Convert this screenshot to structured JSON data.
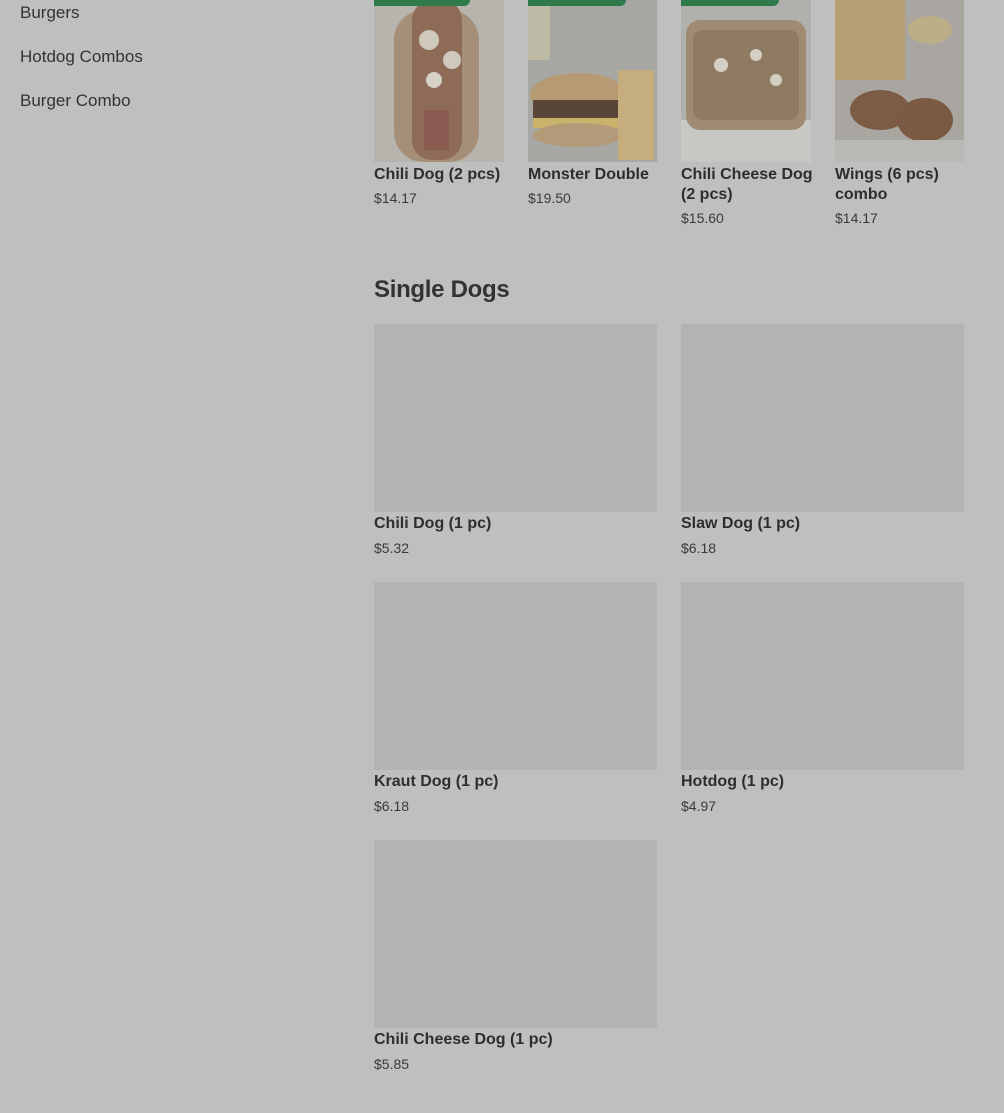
{
  "sidebar": {
    "items": [
      {
        "label": "Burgers"
      },
      {
        "label": "Hotdog Combos"
      },
      {
        "label": "Burger Combo"
      }
    ]
  },
  "featured": [
    {
      "name": "Chili Dog (2 pcs)",
      "price": "$14.17"
    },
    {
      "name": "Monster Double",
      "price": "$19.50"
    },
    {
      "name": "Chili Cheese Dog (2 pcs)",
      "price": "$15.60"
    },
    {
      "name": "Wings (6 pcs) combo",
      "price": "$14.17"
    }
  ],
  "single_dogs": {
    "title": "Single Dogs",
    "items": [
      {
        "name": "Chili Dog (1 pc)",
        "price": "$5.32"
      },
      {
        "name": "Slaw Dog (1 pc)",
        "price": "$6.18"
      },
      {
        "name": "Kraut Dog (1 pc)",
        "price": "$6.18"
      },
      {
        "name": "Hotdog (1 pc)",
        "price": "$4.97"
      },
      {
        "name": "Chili Cheese Dog (1 pc)",
        "price": "$5.85"
      }
    ]
  },
  "colors": {
    "overlay_background": "#bfbfbf",
    "badge": "#2f7a4a",
    "placeholder_image": "#b3b3b3"
  }
}
